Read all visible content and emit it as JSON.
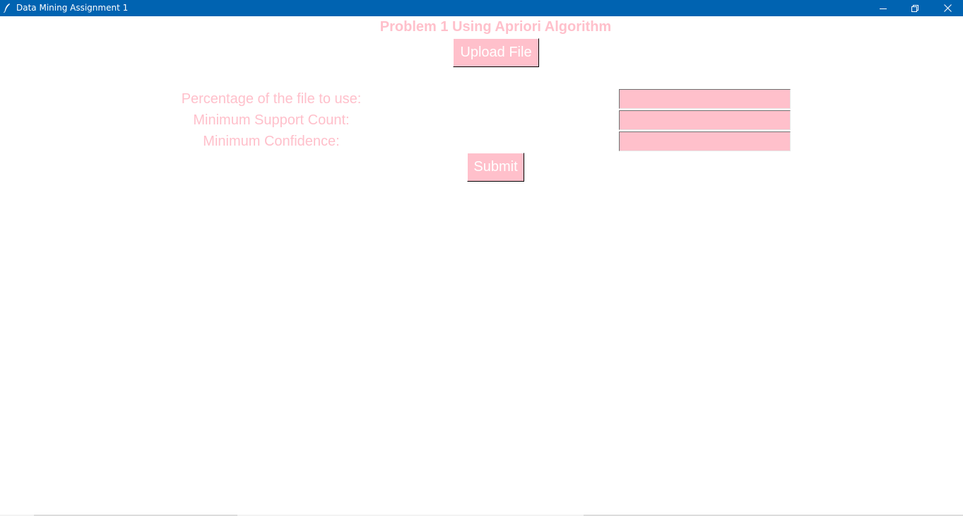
{
  "window": {
    "title": "Data Mining Assignment 1",
    "icon": "feather-icon",
    "controls": [
      "minimize-icon",
      "restore-icon",
      "close-icon"
    ],
    "titlebar_color": "#0063b1"
  },
  "main": {
    "heading": "Problem 1 Using Apriori Algorithm",
    "upload_label": "Upload File",
    "submit_label": "Submit",
    "accent_color": "#ffc0cb"
  },
  "form": {
    "fields": [
      {
        "label": "Percentage of the file to use:",
        "value": ""
      },
      {
        "label": "Minimum Support Count:",
        "value": ""
      },
      {
        "label": "Minimum Confidence:",
        "value": ""
      }
    ]
  }
}
